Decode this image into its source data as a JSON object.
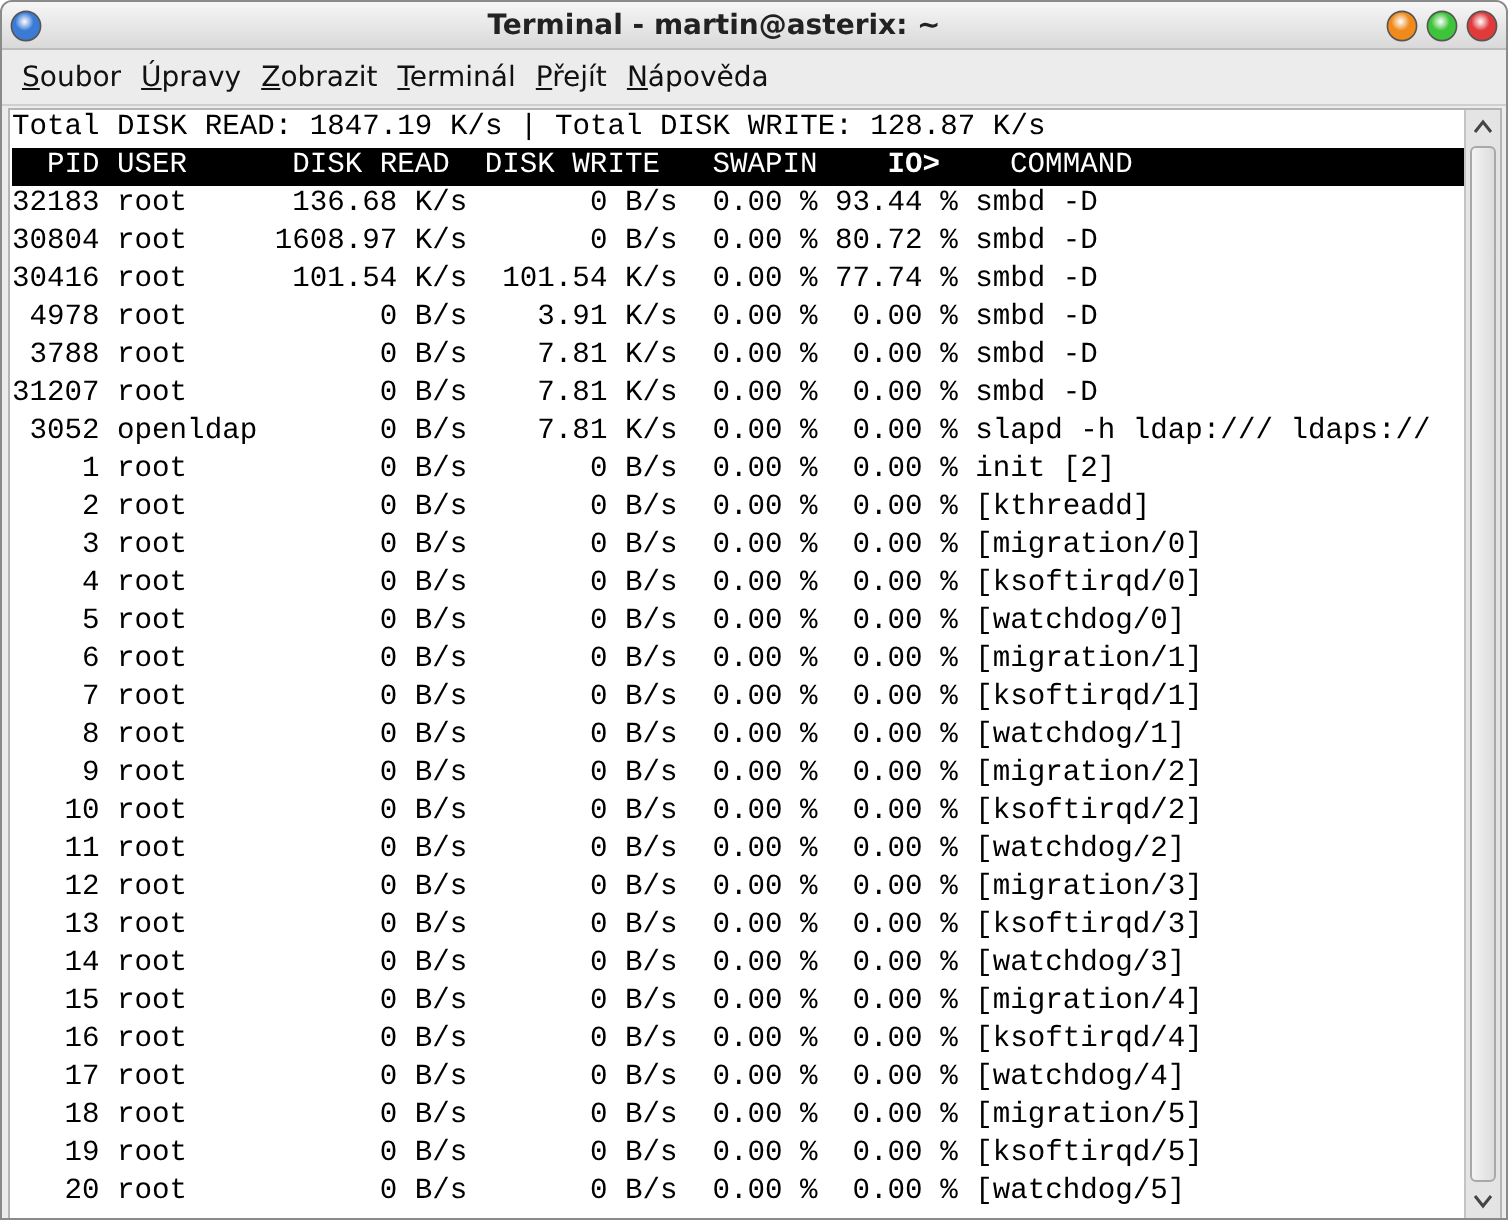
{
  "window": {
    "title": "Terminal - martin@asterix: ~"
  },
  "menu": [
    "Soubor",
    "Úpravy",
    "Zobrazit",
    "Terminál",
    "Přejít",
    "Nápověda"
  ],
  "summary": "Total DISK READ: 1847.19 K/s | Total DISK WRITE: 128.87 K/s",
  "columns": [
    {
      "label": "PID",
      "sorted": false
    },
    {
      "label": "USER",
      "sorted": false
    },
    {
      "label": "DISK READ",
      "sorted": false
    },
    {
      "label": "DISK WRITE",
      "sorted": false
    },
    {
      "label": "SWAPIN",
      "sorted": false
    },
    {
      "label": "IO>",
      "sorted": true
    },
    {
      "label": "COMMAND",
      "sorted": false
    }
  ],
  "rows": [
    {
      "pid": "32183",
      "user": "root",
      "read": "136.68 K/s",
      "write": "0 B/s",
      "swapin": "0.00 %",
      "io": "93.44 %",
      "command": "smbd -D"
    },
    {
      "pid": "30804",
      "user": "root",
      "read": "1608.97 K/s",
      "write": "0 B/s",
      "swapin": "0.00 %",
      "io": "80.72 %",
      "command": "smbd -D"
    },
    {
      "pid": "30416",
      "user": "root",
      "read": "101.54 K/s",
      "write": "101.54 K/s",
      "swapin": "0.00 %",
      "io": "77.74 %",
      "command": "smbd -D"
    },
    {
      "pid": "4978",
      "user": "root",
      "read": "0 B/s",
      "write": "3.91 K/s",
      "swapin": "0.00 %",
      "io": "0.00 %",
      "command": "smbd -D"
    },
    {
      "pid": "3788",
      "user": "root",
      "read": "0 B/s",
      "write": "7.81 K/s",
      "swapin": "0.00 %",
      "io": "0.00 %",
      "command": "smbd -D"
    },
    {
      "pid": "31207",
      "user": "root",
      "read": "0 B/s",
      "write": "7.81 K/s",
      "swapin": "0.00 %",
      "io": "0.00 %",
      "command": "smbd -D"
    },
    {
      "pid": "3052",
      "user": "openldap",
      "read": "0 B/s",
      "write": "7.81 K/s",
      "swapin": "0.00 %",
      "io": "0.00 %",
      "command": "slapd -h ldap:/// ldaps://"
    },
    {
      "pid": "1",
      "user": "root",
      "read": "0 B/s",
      "write": "0 B/s",
      "swapin": "0.00 %",
      "io": "0.00 %",
      "command": "init [2]"
    },
    {
      "pid": "2",
      "user": "root",
      "read": "0 B/s",
      "write": "0 B/s",
      "swapin": "0.00 %",
      "io": "0.00 %",
      "command": "[kthreadd]"
    },
    {
      "pid": "3",
      "user": "root",
      "read": "0 B/s",
      "write": "0 B/s",
      "swapin": "0.00 %",
      "io": "0.00 %",
      "command": "[migration/0]"
    },
    {
      "pid": "4",
      "user": "root",
      "read": "0 B/s",
      "write": "0 B/s",
      "swapin": "0.00 %",
      "io": "0.00 %",
      "command": "[ksoftirqd/0]"
    },
    {
      "pid": "5",
      "user": "root",
      "read": "0 B/s",
      "write": "0 B/s",
      "swapin": "0.00 %",
      "io": "0.00 %",
      "command": "[watchdog/0]"
    },
    {
      "pid": "6",
      "user": "root",
      "read": "0 B/s",
      "write": "0 B/s",
      "swapin": "0.00 %",
      "io": "0.00 %",
      "command": "[migration/1]"
    },
    {
      "pid": "7",
      "user": "root",
      "read": "0 B/s",
      "write": "0 B/s",
      "swapin": "0.00 %",
      "io": "0.00 %",
      "command": "[ksoftirqd/1]"
    },
    {
      "pid": "8",
      "user": "root",
      "read": "0 B/s",
      "write": "0 B/s",
      "swapin": "0.00 %",
      "io": "0.00 %",
      "command": "[watchdog/1]"
    },
    {
      "pid": "9",
      "user": "root",
      "read": "0 B/s",
      "write": "0 B/s",
      "swapin": "0.00 %",
      "io": "0.00 %",
      "command": "[migration/2]"
    },
    {
      "pid": "10",
      "user": "root",
      "read": "0 B/s",
      "write": "0 B/s",
      "swapin": "0.00 %",
      "io": "0.00 %",
      "command": "[ksoftirqd/2]"
    },
    {
      "pid": "11",
      "user": "root",
      "read": "0 B/s",
      "write": "0 B/s",
      "swapin": "0.00 %",
      "io": "0.00 %",
      "command": "[watchdog/2]"
    },
    {
      "pid": "12",
      "user": "root",
      "read": "0 B/s",
      "write": "0 B/s",
      "swapin": "0.00 %",
      "io": "0.00 %",
      "command": "[migration/3]"
    },
    {
      "pid": "13",
      "user": "root",
      "read": "0 B/s",
      "write": "0 B/s",
      "swapin": "0.00 %",
      "io": "0.00 %",
      "command": "[ksoftirqd/3]"
    },
    {
      "pid": "14",
      "user": "root",
      "read": "0 B/s",
      "write": "0 B/s",
      "swapin": "0.00 %",
      "io": "0.00 %",
      "command": "[watchdog/3]"
    },
    {
      "pid": "15",
      "user": "root",
      "read": "0 B/s",
      "write": "0 B/s",
      "swapin": "0.00 %",
      "io": "0.00 %",
      "command": "[migration/4]"
    },
    {
      "pid": "16",
      "user": "root",
      "read": "0 B/s",
      "write": "0 B/s",
      "swapin": "0.00 %",
      "io": "0.00 %",
      "command": "[ksoftirqd/4]"
    },
    {
      "pid": "17",
      "user": "root",
      "read": "0 B/s",
      "write": "0 B/s",
      "swapin": "0.00 %",
      "io": "0.00 %",
      "command": "[watchdog/4]"
    },
    {
      "pid": "18",
      "user": "root",
      "read": "0 B/s",
      "write": "0 B/s",
      "swapin": "0.00 %",
      "io": "0.00 %",
      "command": "[migration/5]"
    },
    {
      "pid": "19",
      "user": "root",
      "read": "0 B/s",
      "write": "0 B/s",
      "swapin": "0.00 %",
      "io": "0.00 %",
      "command": "[ksoftirqd/5]"
    },
    {
      "pid": "20",
      "user": "root",
      "read": "0 B/s",
      "write": "0 B/s",
      "swapin": "0.00 %",
      "io": "0.00 %",
      "command": "[watchdog/5]"
    }
  ]
}
